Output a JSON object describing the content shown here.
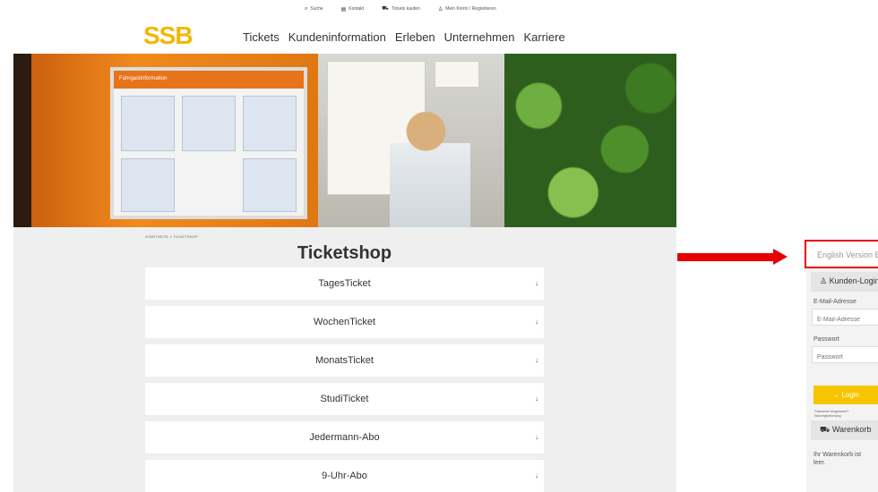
{
  "top_links": [
    {
      "icon": "search-icon",
      "label": "Suche"
    },
    {
      "icon": "contact-icon",
      "label": "Kontakt"
    },
    {
      "icon": "cart-icon",
      "label": "Tickets kaufen"
    },
    {
      "icon": "user-icon",
      "label": "Mein Konto / Registrieren"
    }
  ],
  "logo": "SSB",
  "main_nav": [
    "Tickets",
    "Kundeninformation",
    "Erleben",
    "Unternehmen",
    "Karriere"
  ],
  "hero": {
    "board_header": "Fahrgastinformation"
  },
  "breadcrumb": "STARTSEITE  »  TICKETSHOP",
  "page_title": "Ticketshop",
  "tickets": [
    {
      "label": "TagesTicket"
    },
    {
      "label": "WochenTicket"
    },
    {
      "label": "MonatsTicket"
    },
    {
      "label": "StudiTicket"
    },
    {
      "label": "Jedermann-Abo"
    },
    {
      "label": "9-Uhr-Abo"
    }
  ],
  "expand_icon": "↓",
  "sidebar": {
    "english_link": "English Version E",
    "login_title": "Kunden-Login",
    "email_label": "E-Mail-Adresse",
    "email_placeholder": "E-Mail-Adresse",
    "password_label": "Passwort",
    "password_placeholder": "Passwort",
    "login_button": "→  Login",
    "forgot_password": "Passwort vergessen?",
    "register": "Neuregistrierung",
    "cart_title": "Warenkorb",
    "cart_empty": "Ihr Warenkorb ist leer."
  },
  "colors": {
    "brand": "#f2b705",
    "highlight": "#e60000"
  }
}
